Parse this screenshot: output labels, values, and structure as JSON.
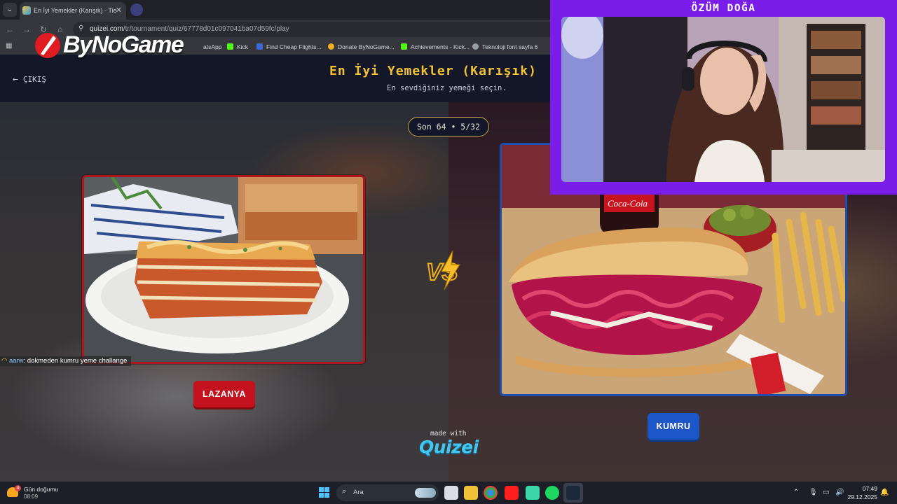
{
  "browser": {
    "tab_title": "En İyi Yemekler (Karışık) - Tier L",
    "url_domain": "quizei.com",
    "url_path": "/tr/tournament/quiz/67778d01c097041ba07d59fc/play",
    "bookmarks": [
      {
        "label": "atsApp",
        "icon": "whatsapp-icon",
        "color": "#25d366"
      },
      {
        "label": "Kick",
        "icon": "kick-icon",
        "color": "#53fc18"
      },
      {
        "label": "Find Cheap Flights...",
        "icon": "flight-icon",
        "color": "#3b6bd6"
      },
      {
        "label": "Donate ByNoGame...",
        "icon": "donate-icon",
        "color": "#f2b01e"
      },
      {
        "label": "Achievements - Kick...",
        "icon": "kick-icon",
        "color": "#53fc18"
      },
      {
        "label": "Teknoloji font sayfa 6",
        "icon": "globe-icon",
        "color": "#9aa0a8"
      }
    ]
  },
  "overlay": {
    "brand_logo": "ByNoGame",
    "streamer_name": "ÖZÜM DOĞA",
    "chat": {
      "user": "aarw",
      "message": ": dokmeden kumru yeme challange"
    }
  },
  "quiz": {
    "exit_label": "ÇIKIŞ",
    "title": "En İyi Yemekler (Karışık)",
    "subtitle": "En sevdiğiniz yemeği seçin.",
    "round": "Son 64 • 5/32",
    "vs_label": "VS",
    "option_left": {
      "label": "LAZANYA",
      "color": "#c3121d"
    },
    "option_right": {
      "label": "KUMRU",
      "color": "#1d57c7"
    },
    "made_with": "made with",
    "brand": "Quizei"
  },
  "taskbar": {
    "weather_title": "Gün doğumu",
    "weather_time": "08:09",
    "weather_badge": "4",
    "search_placeholder": "Ara",
    "clock_time": "07:49",
    "clock_date": "29.12.2025"
  }
}
